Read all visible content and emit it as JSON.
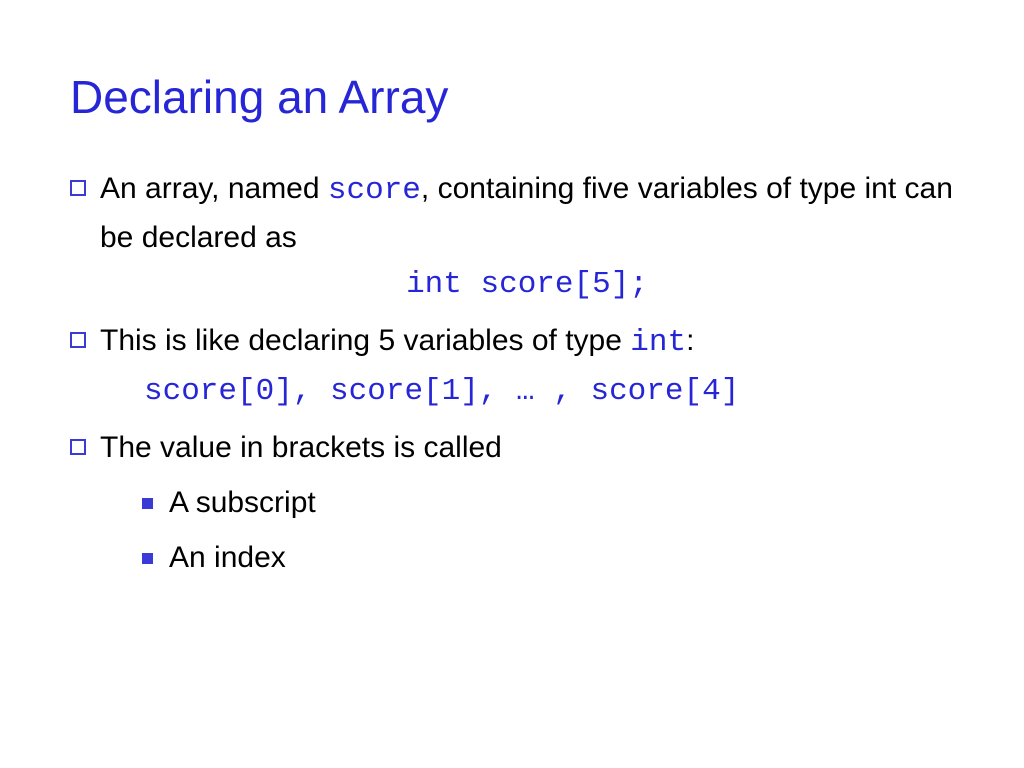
{
  "title": "Declaring an Array",
  "bullets": [
    {
      "parts": [
        {
          "t": "An array, named ",
          "c": ""
        },
        {
          "t": "score",
          "c": "code"
        },
        {
          "t": ", containing five variables of type int can be declared as",
          "c": ""
        }
      ],
      "codeline": "int score[5];",
      "codelineClass": "code-line"
    },
    {
      "parts": [
        {
          "t": "This is like declaring 5 variables of type ",
          "c": ""
        },
        {
          "t": "int",
          "c": "code"
        },
        {
          "t": ":",
          "c": ""
        }
      ],
      "codeline": "score[0], score[1], … , score[4]",
      "codelineClass": "code-line2"
    },
    {
      "parts": [
        {
          "t": "The value in brackets is called",
          "c": ""
        }
      ],
      "sub": [
        "A subscript",
        "An index"
      ]
    }
  ]
}
